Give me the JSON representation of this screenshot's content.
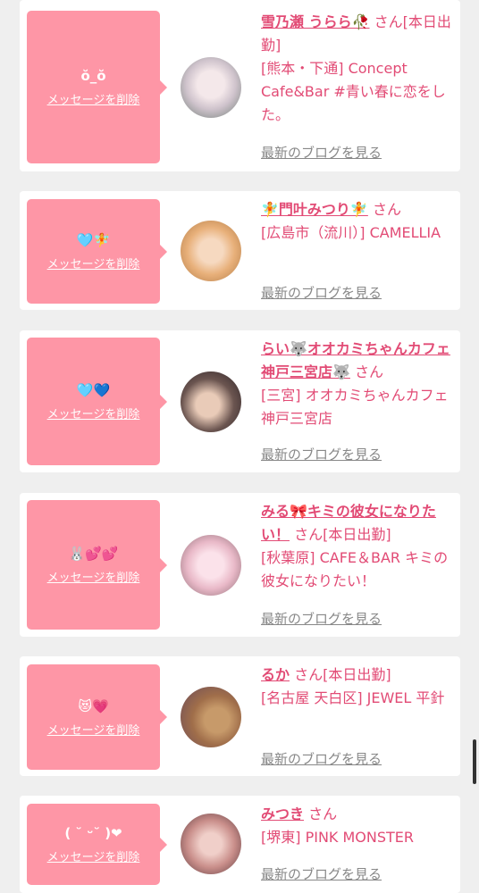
{
  "delete_label": "メッセージを削除",
  "blog_label": "最新のブログを見る",
  "san_label": "さん",
  "cards": [
    {
      "message": "ŏ_ŏ",
      "name": "雪乃瀬 うらら🥀",
      "suffix": "[本日出勤]",
      "shop": "[熊本・下通] Concept Cafe&Bar #青い春に恋をした。"
    },
    {
      "message": "🩵🧚",
      "name": "🧚門叶みつり🧚",
      "suffix": "",
      "shop": "[広島市（流川）] CAMELLIA"
    },
    {
      "message": "🩵💙",
      "name": "らい🐺オオカミちゃんカフェ神戸三宮店🐺",
      "suffix": "",
      "shop": "[三宮] オオカミちゃんカフェ神戸三宮店"
    },
    {
      "message": "🐰💕💕",
      "name": "みる🎀キミの彼女になりたい！",
      "suffix": "[本日出勤]",
      "shop": "[秋葉原] CAFE＆BAR キミの彼女になりたい！"
    },
    {
      "message": "😻💗",
      "name": "るか",
      "suffix": "[本日出勤]",
      "shop": "[名古屋 天白区] JEWEL 平針"
    },
    {
      "message": "( ˘ ᵕ˘ )❤︎",
      "name": "みつき",
      "suffix": "",
      "shop": "[堺東] PINK MONSTER"
    }
  ]
}
